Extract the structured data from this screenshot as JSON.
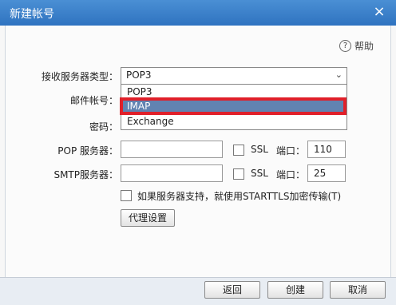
{
  "window": {
    "title": "新建帐号",
    "close_label": "×"
  },
  "help": {
    "icon": "question-circle-icon",
    "glyph": "?",
    "label": "帮助"
  },
  "form": {
    "server_type_label": "接收服务器类型：",
    "server_type_value": "POP3",
    "server_type_options": [
      "POP3",
      "IMAP",
      "Exchange"
    ],
    "highlighted_option": "IMAP",
    "account_label": "邮件帐号：",
    "password_label": "密码：",
    "pop_label": "POP 服务器：",
    "pop_value": "",
    "pop_ssl_label": "SSL",
    "pop_port_label": "端口：",
    "pop_port_value": "110",
    "smtp_label": "SMTP服务器：",
    "smtp_value": "",
    "smtp_ssl_label": "SSL",
    "smtp_port_label": "端口：",
    "smtp_port_value": "25",
    "starttls_label": "如果服务器支持，就使用STARTTLS加密传输(T)",
    "proxy_button": "代理设置"
  },
  "footer": {
    "back": "返回",
    "create": "创建",
    "cancel": "取消"
  },
  "colors": {
    "titlebar": "#2f73c0",
    "selected": "#6183b1",
    "annotation": "#e0202a"
  }
}
